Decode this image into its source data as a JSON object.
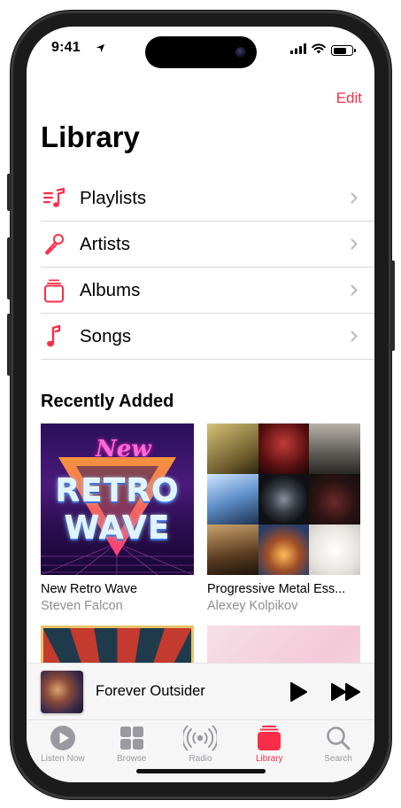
{
  "status": {
    "time": "9:41"
  },
  "header": {
    "edit_label": "Edit",
    "title": "Library"
  },
  "menu": [
    {
      "label": "Playlists",
      "icon": "playlists-icon"
    },
    {
      "label": "Artists",
      "icon": "microphone-icon"
    },
    {
      "label": "Albums",
      "icon": "albums-icon"
    },
    {
      "label": "Songs",
      "icon": "music-note-icon"
    }
  ],
  "recently_added": {
    "title": "Recently Added",
    "albums": [
      {
        "title": "New Retro Wave",
        "artist": "Steven Falcon"
      },
      {
        "title": "Progressive Metal Ess...",
        "artist": "Alexey Kolpikov"
      }
    ],
    "art_texts": {
      "retro_top": "New",
      "retro_mid": "RETRO",
      "retro_bottom": "WAVE"
    }
  },
  "now_playing": {
    "title": "Forever Outsider"
  },
  "tabs": [
    {
      "label": "Listen Now",
      "active": false
    },
    {
      "label": "Browse",
      "active": false
    },
    {
      "label": "Radio",
      "active": false
    },
    {
      "label": "Library",
      "active": true
    },
    {
      "label": "Search",
      "active": false
    }
  ],
  "colors": {
    "accent": "#fa2d48",
    "secondary_text": "#8e8e93",
    "inactive_tab": "#9a9aa0"
  }
}
